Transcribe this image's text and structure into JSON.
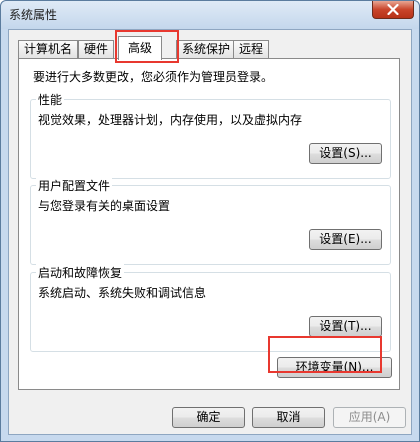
{
  "window": {
    "title": "系统属性"
  },
  "tabs": [
    {
      "label": "计算机名",
      "active": false
    },
    {
      "label": "硬件",
      "active": false
    },
    {
      "label": "高级",
      "active": true
    },
    {
      "label": "系统保护",
      "active": false
    },
    {
      "label": "远程",
      "active": false
    }
  ],
  "panel": {
    "notice": "要进行大多数更改，您必须作为管理员登录。",
    "performance": {
      "title": "性能",
      "description": "视觉效果，处理器计划，内存使用，以及虚拟内存",
      "settings_button": "设置(S)..."
    },
    "user_profiles": {
      "title": "用户配置文件",
      "description": "与您登录有关的桌面设置",
      "settings_button": "设置(E)..."
    },
    "startup_recovery": {
      "title": "启动和故障恢复",
      "description": "系统启动、系统失败和调试信息",
      "settings_button": "设置(T)..."
    },
    "env_button": "环境变量(N)..."
  },
  "footer": {
    "ok": "确定",
    "cancel": "取消",
    "apply": "应用(A)"
  },
  "colors": {
    "highlight": "#e8382f",
    "close_button": "#c9452b"
  }
}
